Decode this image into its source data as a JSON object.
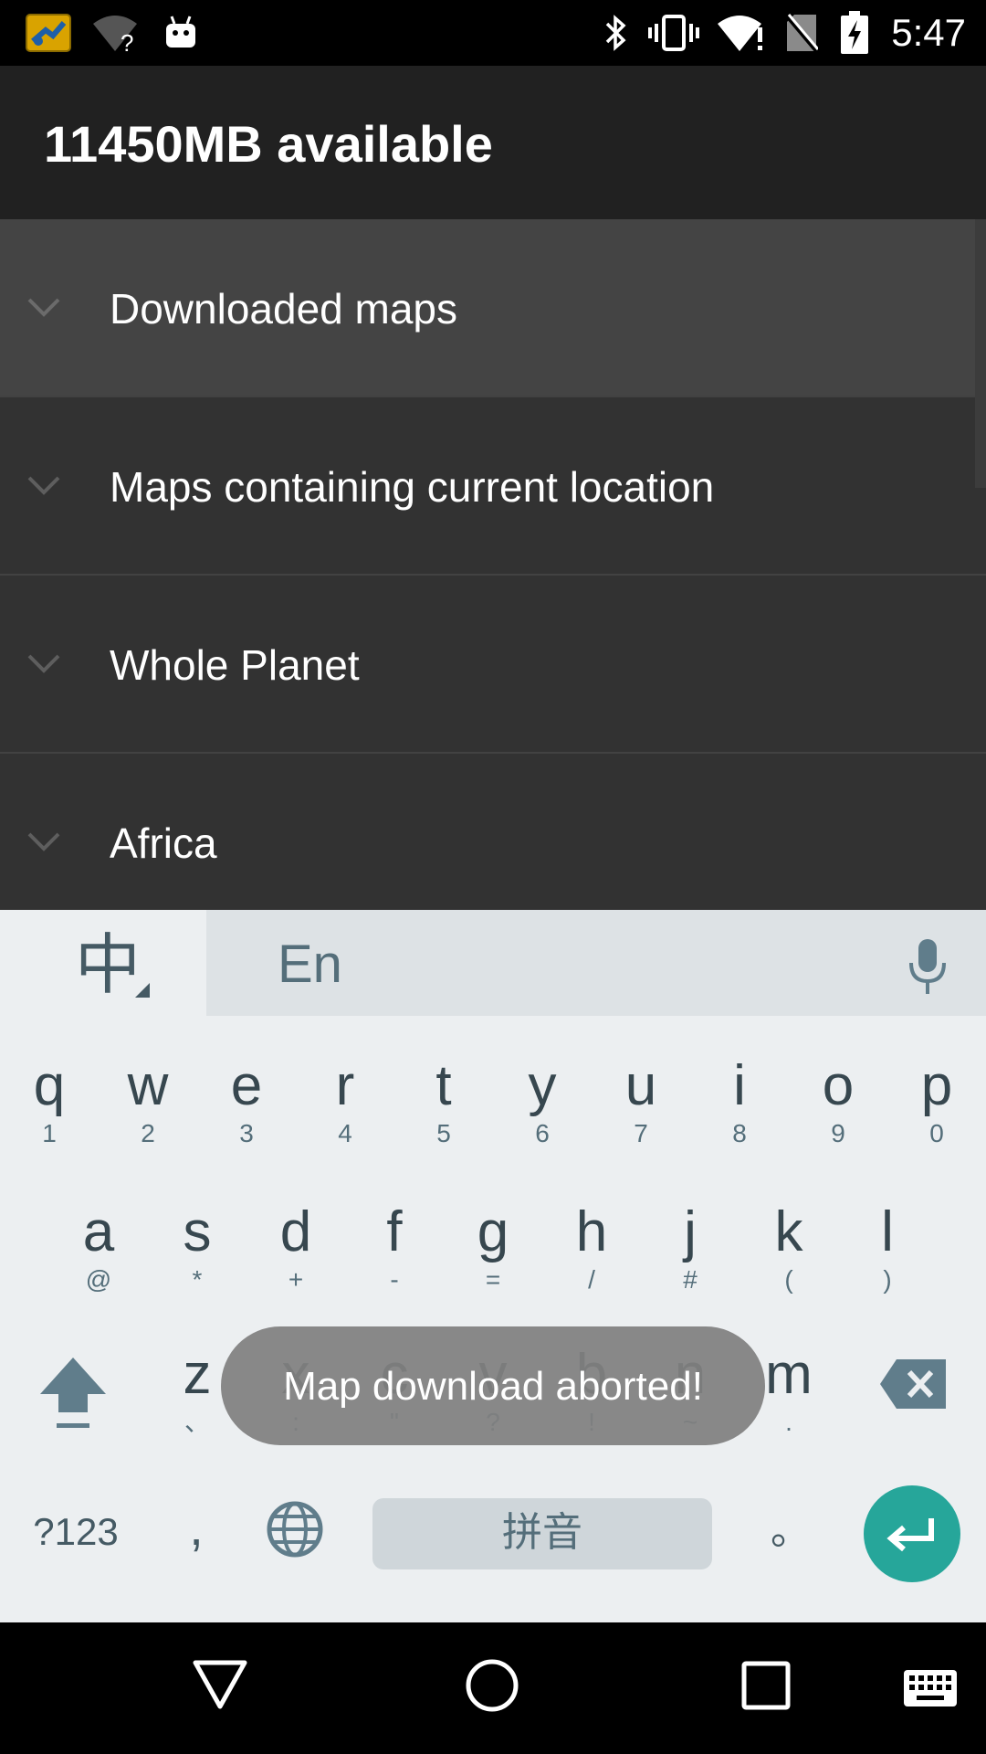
{
  "status_bar": {
    "time": "5:47",
    "icons": [
      "app-notification-icon",
      "wifi-unknown-icon",
      "android-debug-icon",
      "bluetooth-icon",
      "vibrate-icon",
      "wifi-alert-icon",
      "no-sim-icon",
      "battery-charging-icon"
    ]
  },
  "app_bar": {
    "title": "11450MB available"
  },
  "list": {
    "items": [
      {
        "label": "Downloaded maps"
      },
      {
        "label": "Maps containing current location"
      },
      {
        "label": "Whole Planet"
      },
      {
        "label": "Africa"
      }
    ]
  },
  "keyboard": {
    "lang_label": "中",
    "candidate": "En",
    "row1": [
      {
        "k": "q",
        "s": "1"
      },
      {
        "k": "w",
        "s": "2"
      },
      {
        "k": "e",
        "s": "3"
      },
      {
        "k": "r",
        "s": "4"
      },
      {
        "k": "t",
        "s": "5"
      },
      {
        "k": "y",
        "s": "6"
      },
      {
        "k": "u",
        "s": "7"
      },
      {
        "k": "i",
        "s": "8"
      },
      {
        "k": "o",
        "s": "9"
      },
      {
        "k": "p",
        "s": "0"
      }
    ],
    "row2": [
      {
        "k": "a",
        "s": "@"
      },
      {
        "k": "s",
        "s": "*"
      },
      {
        "k": "d",
        "s": "+"
      },
      {
        "k": "f",
        "s": "-"
      },
      {
        "k": "g",
        "s": "="
      },
      {
        "k": "h",
        "s": "/"
      },
      {
        "k": "j",
        "s": "#"
      },
      {
        "k": "k",
        "s": "("
      },
      {
        "k": "l",
        "s": ")"
      }
    ],
    "row3": [
      {
        "k": "z",
        "s": "、"
      },
      {
        "k": "x",
        "s": ":"
      },
      {
        "k": "c",
        "s": "\""
      },
      {
        "k": "v",
        "s": "?"
      },
      {
        "k": "b",
        "s": "!"
      },
      {
        "k": "n",
        "s": "~"
      },
      {
        "k": "m",
        "s": "."
      }
    ],
    "symbols_label": "?123",
    "comma_label": ",",
    "space_label": "拼音",
    "period_label": "。"
  },
  "toast": {
    "message": "Map download aborted!"
  }
}
